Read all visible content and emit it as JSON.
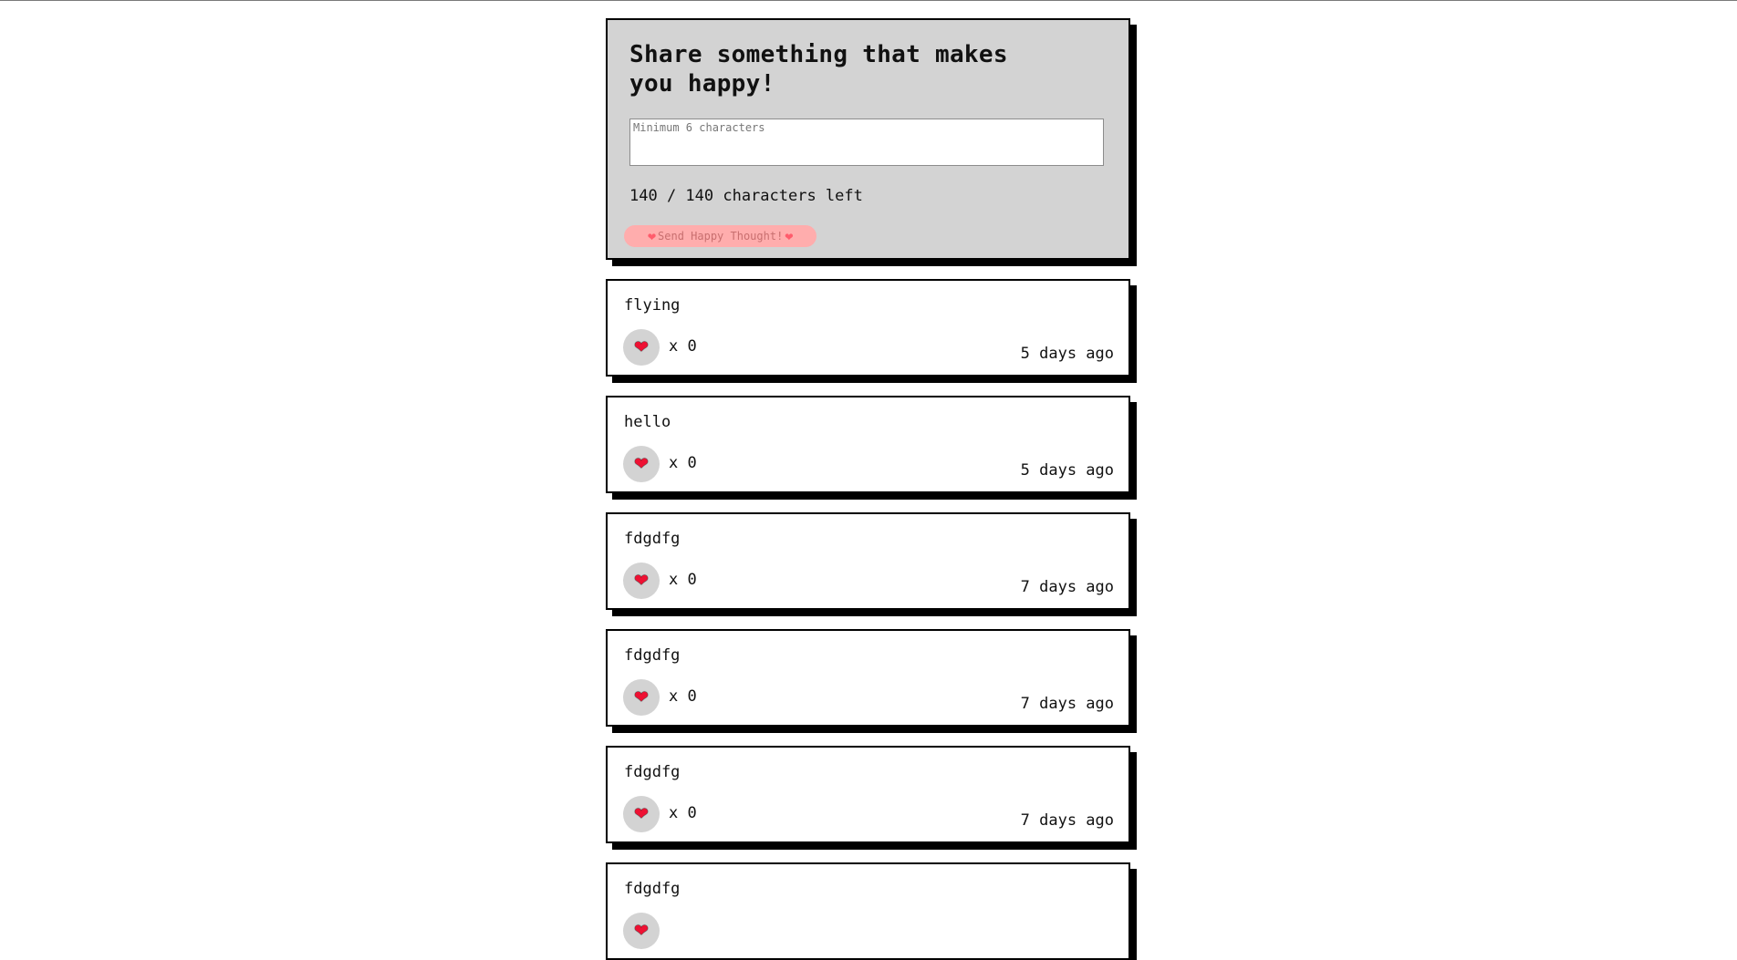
{
  "form": {
    "title": "Share something that makes you happy!",
    "placeholder": "Minimum 6 characters",
    "char_count": "140 / 140 characters left",
    "send_label": "Send Happy Thought!",
    "send_icon": "heart-icon"
  },
  "thoughts": [
    {
      "message": "flying",
      "likes": "x 0",
      "time": "5 days ago"
    },
    {
      "message": "hello",
      "likes": "x 0",
      "time": "5 days ago"
    },
    {
      "message": "fdgdfg",
      "likes": "x 0",
      "time": "7 days ago"
    },
    {
      "message": "fdgdfg",
      "likes": "x 0",
      "time": "7 days ago"
    },
    {
      "message": "fdgdfg",
      "likes": "x 0",
      "time": "7 days ago"
    },
    {
      "message": "fdgdfg",
      "likes": "",
      "time": ""
    }
  ],
  "colors": {
    "form_bg": "#d3d3d3",
    "send_bg": "#ffadad",
    "heart": "#ee1133",
    "like_bg": "#d3d3d3"
  }
}
